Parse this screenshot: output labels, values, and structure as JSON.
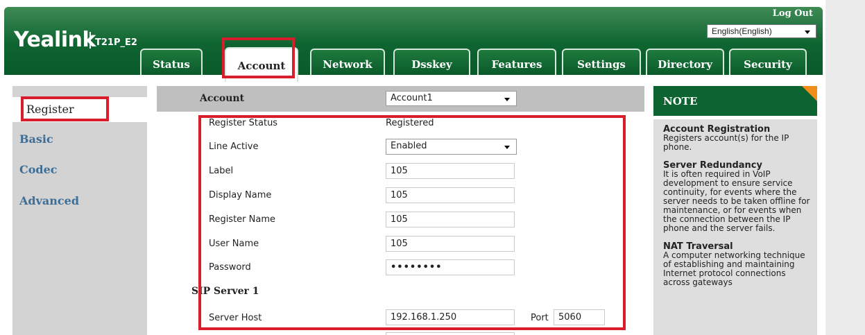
{
  "brand": {
    "logo": "Yealink",
    "model": "T21P_E2"
  },
  "header": {
    "logout": "Log Out",
    "language": "English(English)"
  },
  "tabs": [
    {
      "label": "Status"
    },
    {
      "label": "Account"
    },
    {
      "label": "Network"
    },
    {
      "label": "Dsskey"
    },
    {
      "label": "Features"
    },
    {
      "label": "Settings"
    },
    {
      "label": "Directory"
    },
    {
      "label": "Security"
    }
  ],
  "sidebar": {
    "items": [
      {
        "label": "Register"
      },
      {
        "label": "Basic"
      },
      {
        "label": "Codec"
      },
      {
        "label": "Advanced"
      }
    ]
  },
  "form": {
    "account_label": "Account",
    "account_value": "Account1",
    "register_status_label": "Register Status",
    "register_status_value": "Registered",
    "line_active_label": "Line Active",
    "line_active_value": "Enabled",
    "label_label": "Label",
    "label_value": "105",
    "display_name_label": "Display Name",
    "display_name_value": "105",
    "register_name_label": "Register Name",
    "register_name_value": "105",
    "user_name_label": "User Name",
    "user_name_value": "105",
    "password_label": "Password",
    "password_value": "••••••••",
    "sip_server_label": "SIP Server 1",
    "server_host_label": "Server Host",
    "server_host_value": "192.168.1.250",
    "port_label": "Port",
    "port_value": "5060"
  },
  "note": {
    "title": "NOTE",
    "sections": [
      {
        "title": "Account Registration",
        "text": "Registers account(s) for the IP phone."
      },
      {
        "title": "Server Redundancy",
        "text": "It is often required in VoIP development to ensure service continuity, for events where the server needs to be taken offline for maintenance, or for events when the connection between the IP phone and the server fails."
      },
      {
        "title": "NAT Traversal",
        "text": "A computer networking technique of establishing and maintaining Internet protocol connections across gateways"
      }
    ]
  },
  "colors": {
    "header_green": "#0e6430",
    "highlight_red": "#d81e2c",
    "note_corner": "#f28c1b",
    "nav_link": "#3d6e97"
  }
}
